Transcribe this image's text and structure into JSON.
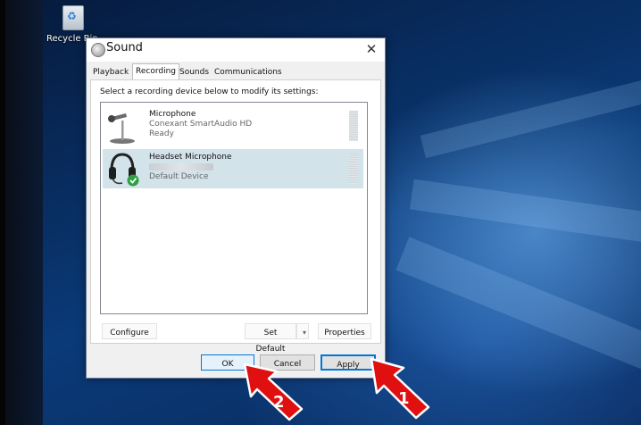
{
  "desktop": {
    "recycle_bin_label": "Recycle Bin"
  },
  "dialog": {
    "title": "Sound",
    "close_glyph": "✕",
    "tabs": [
      "Playback",
      "Recording",
      "Sounds",
      "Communications"
    ],
    "active_tab": "Recording",
    "instruction": "Select a recording device below to modify its settings:",
    "devices": [
      {
        "name": "Microphone",
        "line2": "Conexant SmartAudio HD",
        "line3": "Ready",
        "icon": "microphone-icon",
        "selected": false
      },
      {
        "name": "Headset Microphone",
        "line2": "",
        "line3": "Default Device",
        "icon": "headset-icon",
        "selected": true
      }
    ],
    "buttons": {
      "configure": "Configure",
      "set_default": "Set Default",
      "set_default_arrow": "▾",
      "properties": "Properties",
      "ok": "OK",
      "cancel": "Cancel",
      "apply": "Apply"
    }
  },
  "annotations": [
    {
      "number": "1",
      "icon": "red-arrow-icon",
      "points_to": "apply"
    },
    {
      "number": "2",
      "icon": "red-arrow-icon",
      "points_to": "ok"
    }
  ],
  "colors": {
    "selection": "#d3e3ea",
    "accent": "#0078d7",
    "arrow_red": "#e01010"
  }
}
